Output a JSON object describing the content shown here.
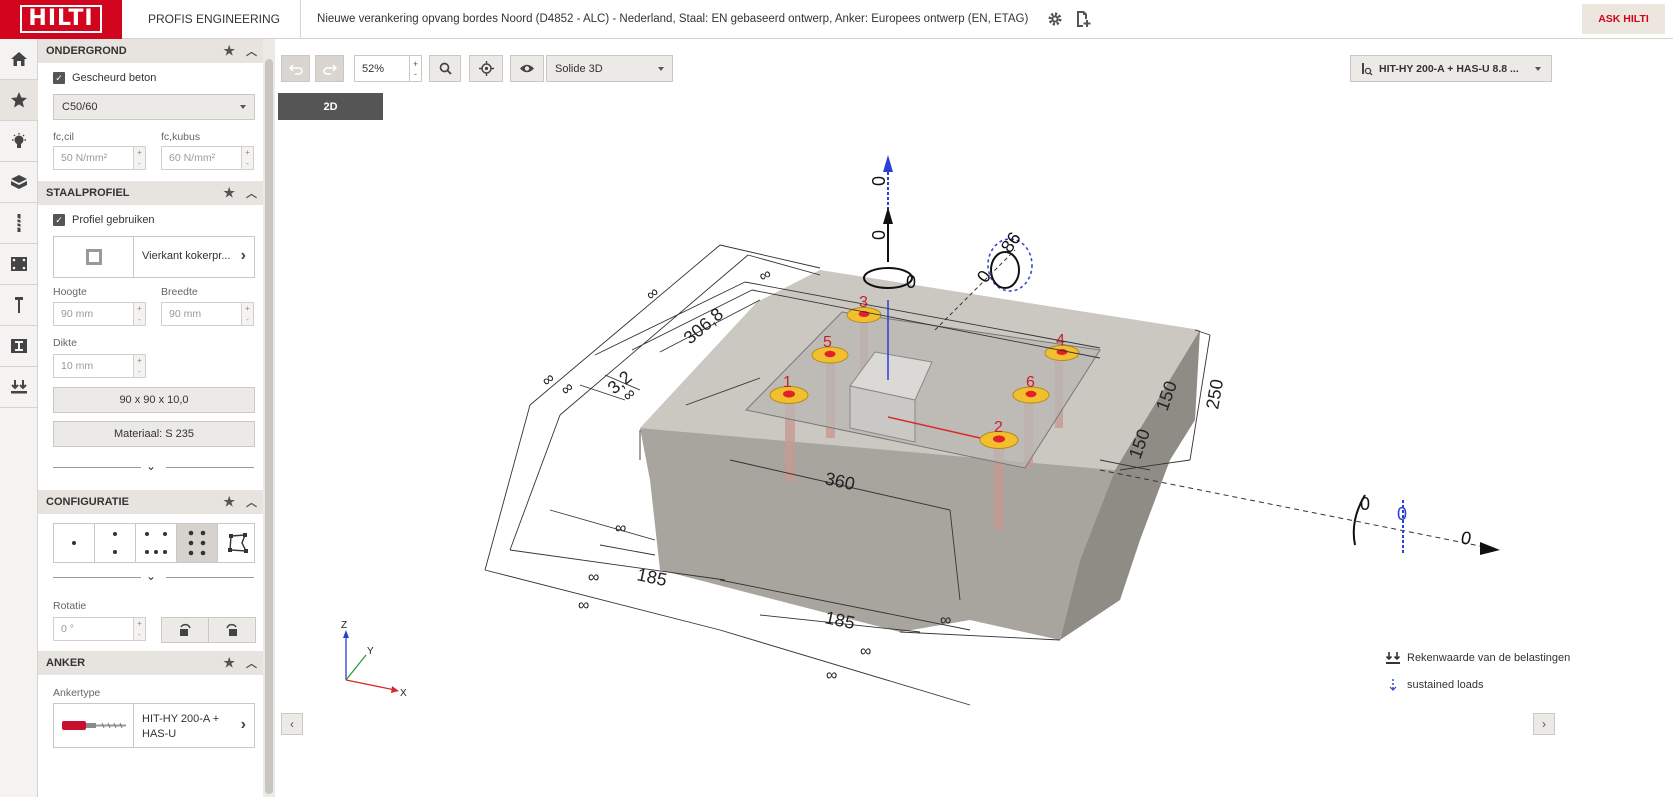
{
  "header": {
    "logo_text": "HILTI",
    "app_name": "PROFIS ENGINEERING",
    "project_title": "Nieuwe verankering opvang bordes Noord (D4852 - ALC) - Nederland, Staal: EN gebaseerd ontwerp, Anker: Europees ontwerp (EN, ETAG)",
    "ask_label": "ASK HILTI",
    "brand_color": "#d2051e"
  },
  "rail": [
    "home-icon",
    "star-icon",
    "lightbulb-icon",
    "cube-icon",
    "anchor-rod-icon",
    "baseplate-icon",
    "profile-icon",
    "column-icon",
    "loads-icon"
  ],
  "sections": {
    "ondergrond": {
      "title": "ONDERGROND",
      "cracked_label": "Gescheurd beton",
      "concrete_class": "C50/60",
      "fc_cyl_label": "fc,cil",
      "fc_cyl_value": "50 N/mm²",
      "fc_cube_label": "fc,kubus",
      "fc_cube_value": "60 N/mm²"
    },
    "staalprofiel": {
      "title": "STAALPROFIEL",
      "use_profile_label": "Profiel gebruiken",
      "profile_type": "Vierkant kokerpr...",
      "height_label": "Hoogte",
      "height_value": "90 mm",
      "width_label": "Breedte",
      "width_value": "90 mm",
      "thickness_label": "Dikte",
      "thickness_value": "10 mm",
      "size_button": "90 x 90 x 10,0",
      "material_button": "Materiaal: S 235"
    },
    "configuratie": {
      "title": "CONFIGURATIE",
      "rotation_label": "Rotatie",
      "rotation_value": "0 °"
    },
    "anker": {
      "title": "ANKER",
      "type_label": "Ankertype",
      "type_value": "HIT-HY 200-A + HAS-U"
    }
  },
  "toolbar": {
    "zoom": "52%",
    "view_mode": "Solide 3D",
    "btn_2d": "2D",
    "anchor_select": "HIT-HY 200-A + HAS-U 8.8 ..."
  },
  "viewport": {
    "dims": {
      "inf": "∞",
      "d306": "306,8",
      "d32": "3,2",
      "d360": "360",
      "d185a": "185",
      "d185b": "185",
      "d150a": "150",
      "d150b": "150",
      "d250": "250",
      "d86": "86"
    },
    "loads": {
      "zero": "0"
    },
    "anchors": [
      "1",
      "2",
      "3",
      "4",
      "5",
      "6"
    ],
    "axes": {
      "x": "X",
      "y": "Y",
      "z": "Z"
    }
  },
  "legend": {
    "design_loads": "Rekenwaarde van de belastingen",
    "sustained": "sustained loads"
  }
}
